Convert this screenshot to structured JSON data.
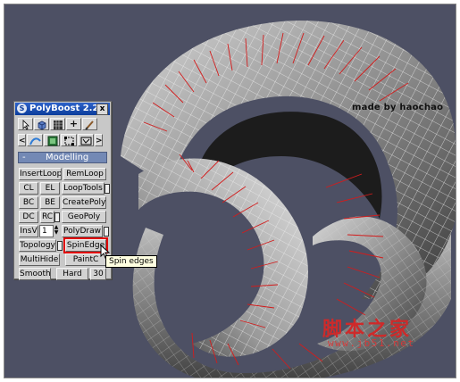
{
  "viewport": {
    "credit": "made by haochao",
    "watermark_cn": "脚本之家",
    "watermark_url": "www.jb51.net",
    "background_color": "#4d5064"
  },
  "panel": {
    "title": "PolyBoost 2.2",
    "close_glyph": "x",
    "toolbar_row1": [
      {
        "icon": "select-arrow-icon"
      },
      {
        "icon": "cube-icon"
      },
      {
        "icon": "grid-icon"
      },
      {
        "icon": "plus-icon",
        "label": "+"
      },
      {
        "icon": "brush-icon"
      }
    ],
    "toolbar_row2": [
      {
        "icon": "chevron-left-icon",
        "label": "<"
      },
      {
        "icon": "paint-icon"
      },
      {
        "icon": "film-icon"
      },
      {
        "icon": "transform-icon"
      },
      {
        "icon": "uv-icon"
      },
      {
        "icon": "chevron-right-icon",
        "label": ">"
      }
    ],
    "section": {
      "toggle": "-",
      "label": "Modelling"
    },
    "buttons": {
      "insertloop": "InsertLoop",
      "remloop": "RemLoop",
      "cl": "CL",
      "el": "EL",
      "looptools": "LoopTools",
      "bc": "BC",
      "be": "BE",
      "createpoly": "CreatePoly",
      "dc": "DC",
      "rc": "RC",
      "geopoly": "GeoPoly",
      "insv": "InsV",
      "insv_value": "1",
      "polydraw": "PolyDraw",
      "topology": "Topology",
      "spinedge": "SpinEdge",
      "multihide": "MultiHide",
      "paintc": "PaintC",
      "smooth": "Smooth",
      "hard": "Hard",
      "n30": "30"
    },
    "highlight_color": "#e00000"
  },
  "tooltip": {
    "text": "Spin edges"
  }
}
